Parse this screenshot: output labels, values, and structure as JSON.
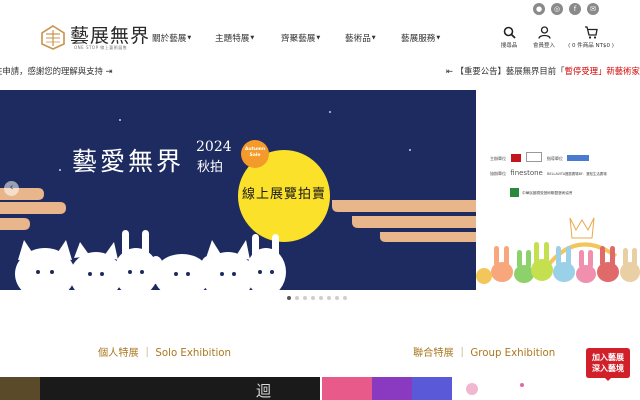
{
  "header": {
    "logo_title": "藝展無界",
    "logo_subtitle": "ONE STOP 線上藝術展售",
    "nav": [
      {
        "label": "關於藝展"
      },
      {
        "label": "主題特展"
      },
      {
        "label": "齊聚藝展"
      },
      {
        "label": "藝術品"
      },
      {
        "label": "藝展服務"
      }
    ],
    "social_icons": [
      "line-icon",
      "instagram-icon",
      "facebook-icon",
      "email-icon"
    ],
    "tools": {
      "search_label": "搜尋品",
      "member_label": "會員登入",
      "cart_label": "( 0 件商品 NT$0 )"
    }
  },
  "ticker": {
    "left_text": "註申請，感謝您的理解與支持 ⇥",
    "right_prefix": "⇤ 【重要公告】藝展無界目前「",
    "right_highlight": "暫停受理",
    "right_suffix": "」新藝術家簽"
  },
  "banner": {
    "title": "藝愛無界",
    "year": "2024",
    "season": "秋拍",
    "autumn_badge": [
      "Autumn",
      "Sale"
    ],
    "moon_text": "線上展覽拍賣",
    "prev_arrow": "‹"
  },
  "sponsors": {
    "organizer_label": "主辦單位",
    "guide_label": "指導單位",
    "assist_label": "協辦單位",
    "logo_name_1": "finestone",
    "logo_name_2": "BELLAVITA寶麗廣場BF．寶松生活廣場",
    "logo_name_3": "中華民國視覺藝術聯盟藝術協會"
  },
  "carousel": {
    "count": 8,
    "active": 0
  },
  "sections": {
    "solo": "個人特展 ｜ Solo Exhibition",
    "group": "聯合特展 ｜ Group Exhibition"
  },
  "join_badge": {
    "line1": "加入藝展",
    "line2": "深入藝境"
  },
  "thumb_text": "迴"
}
